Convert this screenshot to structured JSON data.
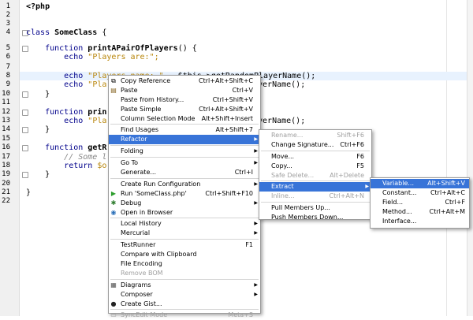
{
  "editor": {
    "line_numbers": [
      "1",
      "2",
      "3",
      "4",
      "5",
      "6",
      "7",
      "8",
      "9",
      "10",
      "11",
      "12",
      "13",
      "14",
      "15",
      "16",
      "17",
      "18",
      "19",
      "20",
      "21",
      "22"
    ],
    "code": {
      "php_open": "<?php",
      "class_kw": "class",
      "class_name": "SomeClass",
      "brace_open": "{",
      "fn_kw": "function",
      "fn1_name": "printAPairOfPlayers",
      "fn1_tail": "() {",
      "echo": "echo",
      "l6_str": "\"Players are:\";",
      "l9_str": "\"Players name: \"",
      "l9_tail": " . $this->getRandomPlayerName();",
      "l10_str": "\"Pla",
      "l10_tail": "ayerName();",
      "brace_close": "}",
      "fn2_name": "prin",
      "l14_str": "\"Pla",
      "l14_tail": "ayerName();",
      "fn3_name": "getR",
      "l18_cm": "// Some l",
      "return_kw": "return",
      "l19_tail": " $o"
    }
  },
  "context_menu": {
    "items": [
      {
        "label": "Copy Reference",
        "shortcut": "Ctrl+Alt+Shift+C"
      },
      {
        "label": "Paste",
        "shortcut": "Ctrl+V"
      },
      {
        "label": "Paste from History...",
        "shortcut": "Ctrl+Shift+V"
      },
      {
        "label": "Paste Simple",
        "shortcut": "Ctrl+Alt+Shift+V"
      },
      {
        "label": "Column Selection Mode",
        "shortcut": "Alt+Shift+Insert"
      },
      {
        "label": "Find Usages",
        "shortcut": "Alt+Shift+7"
      },
      {
        "label": "Refactor",
        "shortcut": ""
      },
      {
        "label": "Folding",
        "shortcut": ""
      },
      {
        "label": "Go To",
        "shortcut": ""
      },
      {
        "label": "Generate...",
        "shortcut": "Ctrl+I"
      },
      {
        "label": "Create Run Configuration",
        "shortcut": ""
      },
      {
        "label": "Run 'SomeClass.php'",
        "shortcut": "Ctrl+Shift+F10"
      },
      {
        "label": "Debug",
        "shortcut": ""
      },
      {
        "label": "Open in Browser",
        "shortcut": ""
      },
      {
        "label": "Local History",
        "shortcut": ""
      },
      {
        "label": "Mercurial",
        "shortcut": ""
      },
      {
        "label": "TestRunner",
        "shortcut": "F1"
      },
      {
        "label": "Compare with Clipboard",
        "shortcut": ""
      },
      {
        "label": "File Encoding",
        "shortcut": ""
      },
      {
        "label": "Remove BOM",
        "shortcut": ""
      },
      {
        "label": "Diagrams",
        "shortcut": ""
      },
      {
        "label": "Composer",
        "shortcut": ""
      },
      {
        "label": "Create Gist...",
        "shortcut": ""
      },
      {
        "label": "SyncEdit Mode",
        "shortcut": "Meta+S"
      }
    ]
  },
  "refactor_menu": {
    "items": [
      {
        "label": "Rename...",
        "shortcut": "Shift+F6"
      },
      {
        "label": "Change Signature...",
        "shortcut": "Ctrl+F6"
      },
      {
        "label": "Move...",
        "shortcut": "F6"
      },
      {
        "label": "Copy...",
        "shortcut": "F5"
      },
      {
        "label": "Safe Delete...",
        "shortcut": "Alt+Delete"
      },
      {
        "label": "Extract",
        "shortcut": ""
      },
      {
        "label": "Inline...",
        "shortcut": "Ctrl+Alt+N"
      },
      {
        "label": "Pull Members Up...",
        "shortcut": ""
      },
      {
        "label": "Push Members Down...",
        "shortcut": ""
      }
    ]
  },
  "extract_menu": {
    "items": [
      {
        "label": "Variable...",
        "shortcut": "Alt+Shift+V"
      },
      {
        "label": "Constant...",
        "shortcut": "Ctrl+Alt+C"
      },
      {
        "label": "Field...",
        "shortcut": "Ctrl+F"
      },
      {
        "label": "Method...",
        "shortcut": "Ctrl+Alt+M"
      },
      {
        "label": "Interface...",
        "shortcut": ""
      }
    ]
  },
  "colors": {
    "selection": "#3874d8",
    "current_line": "#e8f2fe",
    "keyword": "#00008b",
    "string": "#b8860b",
    "comment": "#888888"
  }
}
